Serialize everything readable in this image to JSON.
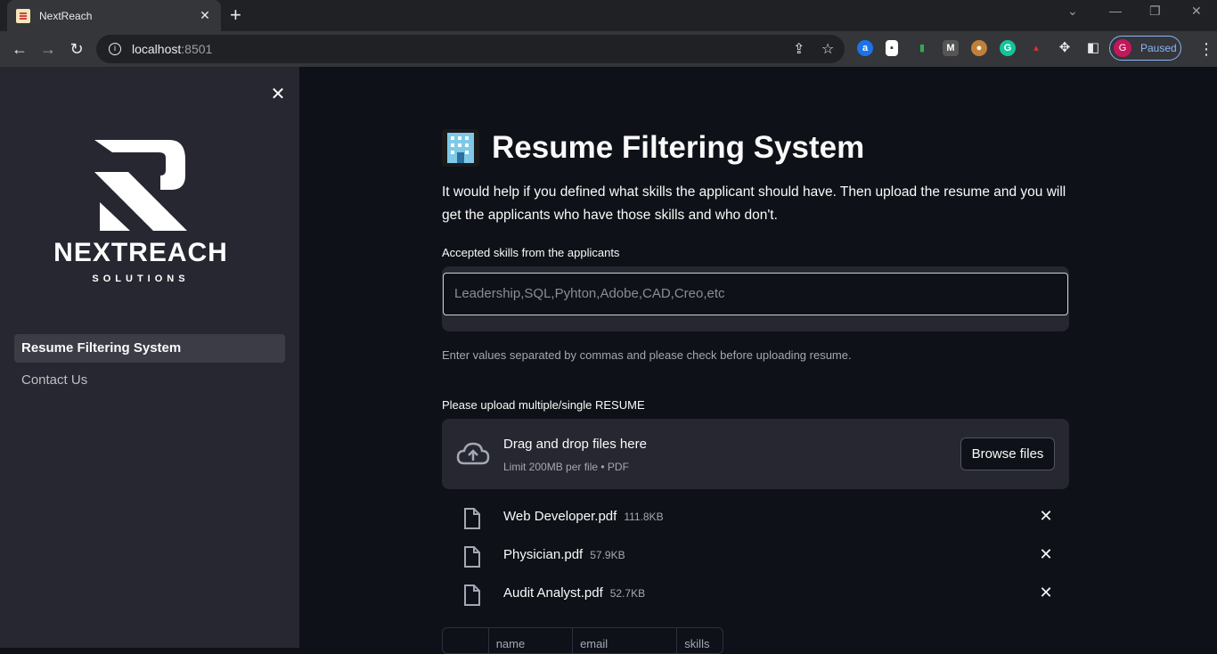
{
  "browser": {
    "tab_title": "NextReach",
    "url_host": "localhost",
    "url_port": ":8501",
    "profile_initial": "G",
    "profile_status": "Paused"
  },
  "sidebar": {
    "logo_word": "NEXTREACH",
    "logo_sub": "SOLUTIONS",
    "items": [
      {
        "label": "Resume Filtering System",
        "active": true
      },
      {
        "label": "Contact Us",
        "active": false
      }
    ]
  },
  "main": {
    "title": "Resume Filtering System",
    "description": "It would help if you defined what skills the applicant should have. Then upload the resume and you will get the applicants who have those skills and who don't.",
    "skills_label": "Accepted skills from the applicants",
    "skills_placeholder": "Leadership,SQL,Pyhton,Adobe,CAD,Creo,etc",
    "skills_hint": "Enter values separated by commas and please check before uploading resume.",
    "upload_label": "Please upload multiple/single RESUME",
    "upload": {
      "title": "Drag and drop files here",
      "limit": "Limit 200MB per file • PDF",
      "browse_label": "Browse files"
    },
    "files": [
      {
        "name": "Web Developer.pdf",
        "size": "111.8KB"
      },
      {
        "name": "Physician.pdf",
        "size": "57.9KB"
      },
      {
        "name": "Audit Analyst.pdf",
        "size": "52.7KB"
      }
    ],
    "table_columns": [
      "",
      "name",
      "email",
      "skills"
    ]
  }
}
